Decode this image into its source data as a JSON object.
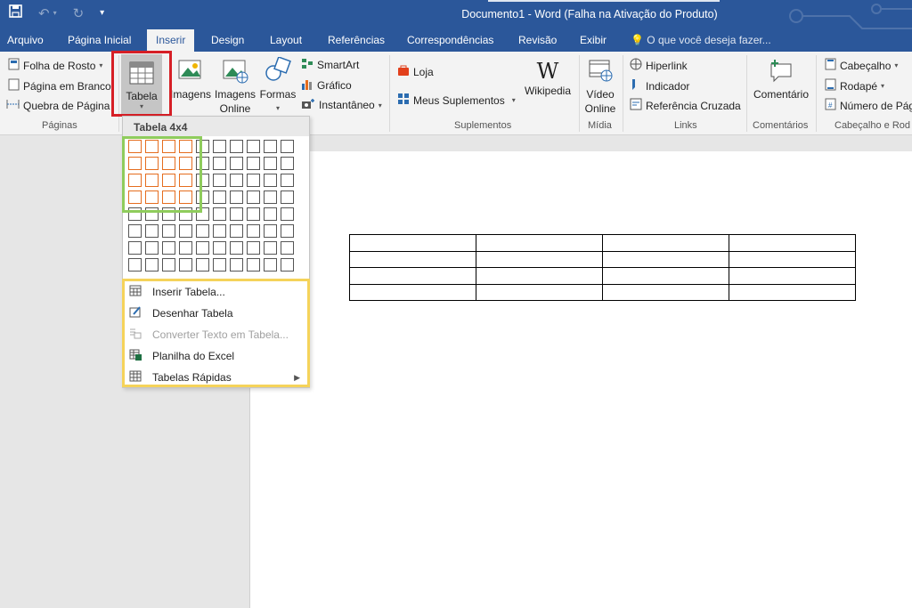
{
  "window": {
    "title": "Documento1 - Word (Falha na Ativação do Produto)"
  },
  "ribbon_tabs": [
    {
      "label": "Arquivo"
    },
    {
      "label": "Página Inicial"
    },
    {
      "label": "Inserir",
      "active": true
    },
    {
      "label": "Design"
    },
    {
      "label": "Layout"
    },
    {
      "label": "Referências"
    },
    {
      "label": "Correspondências"
    },
    {
      "label": "Revisão"
    },
    {
      "label": "Exibir"
    }
  ],
  "tellme": "O que você deseja fazer...",
  "ribbon": {
    "paginas": {
      "label": "Páginas",
      "folha_de_rosto": "Folha de Rosto",
      "pagina_em_branco": "Página em Branco",
      "quebra_de_pagina": "Quebra de Página"
    },
    "tabela": {
      "label": "Tabela"
    },
    "ilustracoes": {
      "imagens": "Imagens",
      "imagens_online_1": "Imagens",
      "imagens_online_2": "Online",
      "formas": "Formas",
      "smartart": "SmartArt",
      "grafico": "Gráfico",
      "instantaneo": "Instantâneo"
    },
    "suplementos": {
      "label": "Suplementos",
      "loja": "Loja",
      "meus_suplementos": "Meus Suplementos",
      "wikipedia": "Wikipedia"
    },
    "midia": {
      "label": "Mídia",
      "video_1": "Vídeo",
      "video_2": "Online"
    },
    "links": {
      "label": "Links",
      "hiperlink": "Hiperlink",
      "indicador": "Indicador",
      "referencia_cruzada": "Referência Cruzada"
    },
    "comentarios": {
      "label": "Comentários",
      "comentario": "Comentário"
    },
    "cabecalho": {
      "label": "Cabeçalho e Rod",
      "cabecalho": "Cabeçalho",
      "rodape": "Rodapé",
      "numero_de_pagina": "Número de Pág"
    }
  },
  "table_dropdown": {
    "header": "Tabela 4x4",
    "grid_cols": 10,
    "grid_rows": 8,
    "selected_cols": 4,
    "selected_rows": 4,
    "menu": [
      {
        "label": "Inserir Tabela...",
        "icon": "insert-table-icon",
        "enabled": true
      },
      {
        "label": "Desenhar Tabela",
        "icon": "draw-table-icon",
        "enabled": true
      },
      {
        "label": "Converter Texto em Tabela...",
        "icon": "convert-text-icon",
        "enabled": false
      },
      {
        "label": "Planilha do Excel",
        "icon": "excel-sheet-icon",
        "enabled": true
      },
      {
        "label": "Tabelas Rápidas",
        "icon": "quick-tables-icon",
        "enabled": true,
        "submenu": true
      }
    ]
  },
  "document": {
    "table_rows": 4,
    "table_cols": 4
  },
  "colors": {
    "brand": "#2b579a",
    "highlight_red": "#d61f26",
    "highlight_green": "#8fcc5c",
    "highlight_yellow": "#f5d35a",
    "grid_selected": "#e56d1f"
  }
}
